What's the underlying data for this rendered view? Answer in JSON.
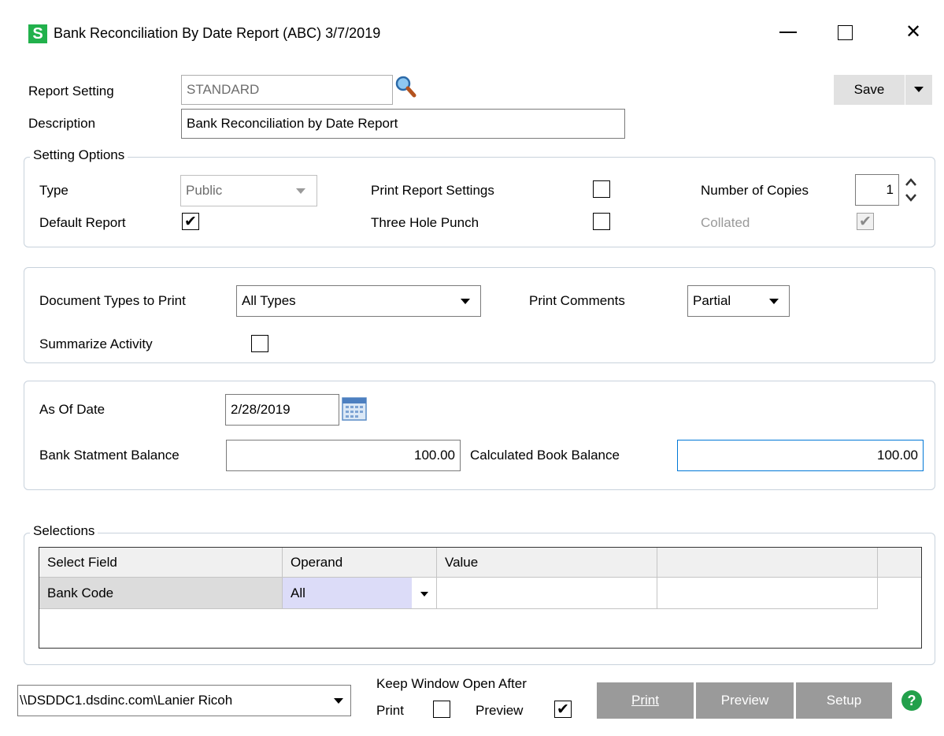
{
  "window": {
    "title": "Bank Reconciliation By Date Report (ABC) 3/7/2019",
    "app_icon_letter": "S",
    "minimize": "—",
    "maximize": "☐",
    "close": "✕"
  },
  "header": {
    "report_setting_label": "Report Setting",
    "report_setting_value": "STANDARD",
    "description_label": "Description",
    "description_value": "Bank Reconciliation by Date Report",
    "save_label": "Save"
  },
  "setting_options": {
    "legend": "Setting Options",
    "type_label": "Type",
    "type_value": "Public",
    "default_report_label": "Default Report",
    "default_report_checked": "✔",
    "print_report_settings_label": "Print Report Settings",
    "three_hole_punch_label": "Three Hole Punch",
    "number_of_copies_label": "Number of Copies",
    "number_of_copies_value": "1",
    "collated_label": "Collated",
    "collated_checked": "✔"
  },
  "options": {
    "doc_types_label": "Document Types to Print",
    "doc_types_value": "All Types",
    "print_comments_label": "Print Comments",
    "print_comments_value": "Partial",
    "summarize_label": "Summarize Activity"
  },
  "dates": {
    "as_of_label": "As Of Date",
    "as_of_value": "2/28/2019",
    "bank_balance_label": "Bank Statment Balance",
    "bank_balance_value": "100.00",
    "book_balance_label": "Calculated Book Balance",
    "book_balance_value": "100.00"
  },
  "selections": {
    "legend": "Selections",
    "columns": [
      "Select Field",
      "Operand",
      "Value",
      ""
    ],
    "rows": [
      {
        "field": "Bank Code",
        "operand": "All",
        "value": ""
      }
    ]
  },
  "footer": {
    "printer": "\\\\DSDDC1.dsdinc.com\\Lanier Ricoh",
    "keep_open_label": "Keep Window Open After",
    "print_label": "Print",
    "preview_label": "Preview",
    "preview_checked": "✔",
    "btn_print": "Print",
    "btn_preview": "Preview",
    "btn_setup": "Setup",
    "help_icon": "?"
  },
  "colors": {
    "accent_green": "#22b14c",
    "button_gray": "#9a9a9a",
    "focus_blue": "#0078d7",
    "operand_bg": "#dcdcf8"
  }
}
